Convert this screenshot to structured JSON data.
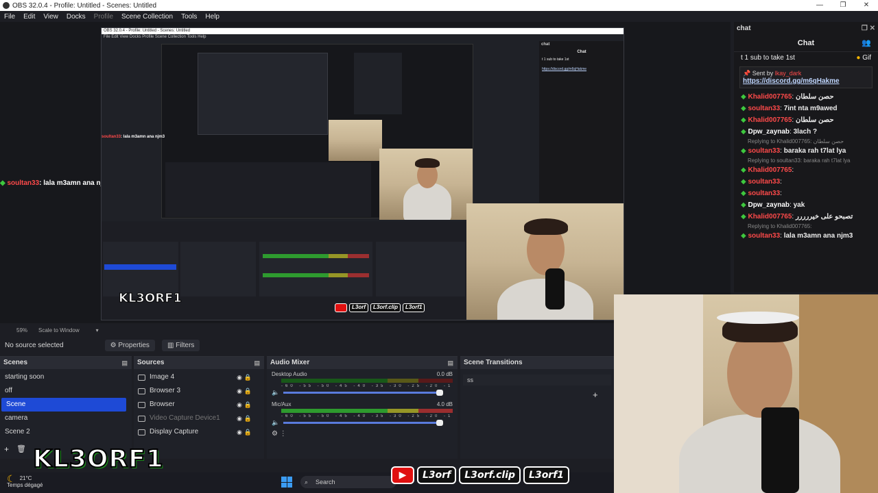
{
  "titlebar": {
    "title": "OBS 32.0.4 - Profile: Untitled - Scenes: Untitled",
    "min": "—",
    "max": "❐",
    "close": "✕"
  },
  "menu": {
    "file": "File",
    "edit": "Edit",
    "view": "View",
    "docks": "Docks",
    "profile": "Profile",
    "scene_collection": "Scene Collection",
    "tools": "Tools",
    "help": "Help"
  },
  "preview": {
    "nested_title": "OBS 32.0.4 - Profile: Untitled - Scenes: Untitled",
    "nested_menu": "File  Edit  View  Docks  Profile  Scene Collection  Tools  Help",
    "chat_overlay_user": "soultan33",
    "chat_overlay_msg": ": lala m3amn ana njm3",
    "brand_small": "KL3ORF1",
    "nested_socials": [
      "L3orf",
      "L3orf.clip",
      "L3orf1"
    ]
  },
  "chat": {
    "dock_title": "chat",
    "header": "Chat",
    "sub_banner": "t 1 sub to take 1st",
    "gif": "Gif",
    "pinned_by": "Sent by",
    "pinned_user": "lkay_dark",
    "pinned_link": "https://discord.gg/m6qHakme",
    "messages": [
      {
        "type": "msg",
        "user": "Khalid007765",
        "color": "#ff4a4a",
        "text": "حصن سلطان"
      },
      {
        "type": "msg",
        "user": "soultan33",
        "color": "#ff4a4a",
        "text": "7int nta m9awed"
      },
      {
        "type": "msg",
        "user": "Khalid007765",
        "color": "#ff4a4a",
        "text": "حصن سلطان"
      },
      {
        "type": "msg",
        "user": "Dpw_zaynab",
        "color": "#ffffff",
        "text": "3lach ?"
      },
      {
        "type": "reply",
        "text": "Replying to Khalid007765: حصن سلطان"
      },
      {
        "type": "msg",
        "user": "soultan33",
        "color": "#ff4a4a",
        "text": "baraka rah t7lat lya"
      },
      {
        "type": "reply",
        "text": "Replying to soultan33: baraka rah t7lat lya"
      },
      {
        "type": "msg",
        "user": "Khalid007765",
        "color": "#ff4a4a",
        "text": ""
      },
      {
        "type": "msg",
        "user": "soultan33",
        "color": "#ff4a4a",
        "text": ""
      },
      {
        "type": "msg",
        "user": "soultan33",
        "color": "#ff4a4a",
        "text": ""
      },
      {
        "type": "msg",
        "user": "Dpw_zaynab",
        "color": "#ffffff",
        "text": "yak"
      },
      {
        "type": "msg",
        "user": "Khalid007765",
        "color": "#ff4a4a",
        "text": "تصبحو على خيررررر"
      },
      {
        "type": "reply",
        "text": "Replying to Khalid007765:"
      },
      {
        "type": "msg",
        "user": "soultan33",
        "color": "#ff4a4a",
        "text": "lala m3amn ana njm3"
      }
    ]
  },
  "toolbar": {
    "zoom": "59%",
    "scale": "Scale to Window"
  },
  "source_bar": {
    "no_source": "No source selected",
    "properties": "Properties",
    "filters": "Filters"
  },
  "scenes": {
    "title": "Scenes",
    "items": [
      "starting soon",
      "off",
      "Scene",
      "camera",
      "Scene 2"
    ],
    "selected": "Scene"
  },
  "sources": {
    "title": "Sources",
    "items": [
      "Image 4",
      "Browser 3",
      "Browser",
      "Video Capture Device1",
      "Display Capture"
    ]
  },
  "mixer": {
    "title": "Audio Mixer",
    "desktop_label": "Desktop Audio",
    "desktop_db": "0.0 dB",
    "mic_label": "Mic/Aux",
    "mic_db": "4.0 dB",
    "ticks": "-60 -55 -50 -45 -40 -35 -30 -25 -20 -15 -10 -5 0"
  },
  "transitions": {
    "title": "Scene Transitions",
    "value": "ss"
  },
  "overlay": {
    "brand": "KL3ORF1",
    "socials": [
      "L3orf",
      "L3orf.clip",
      "L3orf1"
    ],
    "weather_temp": "21°C",
    "weather_text": "Temps dégagé",
    "search": "Search"
  },
  "colors": {
    "selected": "#1e4ad6",
    "brand_green": "#36d136",
    "chat_user_green": "#3ec73e",
    "chat_user_red": "#ff4a4a"
  }
}
